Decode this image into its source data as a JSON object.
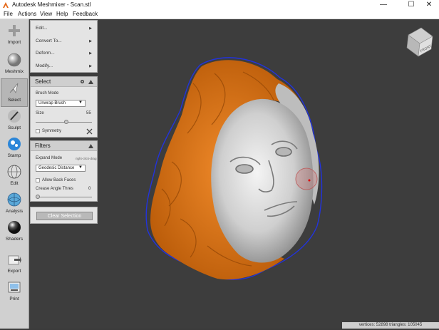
{
  "window": {
    "title": "Autodesk Meshmixer - Scan.stl",
    "controls": {
      "minimize": "—",
      "maximize": "☐",
      "close": "✕"
    }
  },
  "menu": [
    "File",
    "Actions",
    "View",
    "Help",
    "Feedback"
  ],
  "toolbar": [
    {
      "label": "Import",
      "icon": "plus-icon"
    },
    {
      "label": "Meshmix",
      "icon": "sphere-icon"
    },
    {
      "label": "Select",
      "icon": "cursor-arrow-icon",
      "active": true
    },
    {
      "label": "Sculpt",
      "icon": "brush-icon"
    },
    {
      "label": "Stamp",
      "icon": "stamp-icon"
    },
    {
      "label": "Edit",
      "icon": "wireframe-sphere-icon"
    },
    {
      "label": "Analysis",
      "icon": "analysis-sphere-icon"
    },
    {
      "label": "Shaders",
      "icon": "shader-ball-icon"
    },
    {
      "label": "Export",
      "icon": "export-arrow-icon"
    },
    {
      "label": "Print",
      "icon": "printer-icon"
    }
  ],
  "edit_menu": {
    "items": [
      "Edit...",
      "Convert To...",
      "Deform...",
      "Modify..."
    ],
    "arrow": "▶"
  },
  "select_panel": {
    "title": "Select",
    "brush_mode_label": "Brush Mode",
    "brush_mode_value": "Unwrap Brush",
    "size_label": "Size",
    "size_value": "55",
    "size_level": 0.55,
    "symmetry_label": "Symmetry"
  },
  "filters_panel": {
    "title": "Filters",
    "expand_mode_label": "Expand Mode",
    "expand_mode_hint": "right-click-drag",
    "expand_mode_value": "Geodesic Distance",
    "allow_back_faces_label": "Allow Back Faces",
    "crease_angle_label": "Crease Angle Thres",
    "crease_angle_value": "0",
    "crease_level": 0
  },
  "clear_selection_label": "Clear Selection",
  "view_cube": {
    "face_label": "FRONT"
  },
  "status": {
    "text": "vertices: 52898 triangles: 105045"
  },
  "colors": {
    "selection": "#e3730f",
    "mesh": "#c9c9c9",
    "background": "#3d3d3d",
    "boundary": "#2233dd"
  }
}
